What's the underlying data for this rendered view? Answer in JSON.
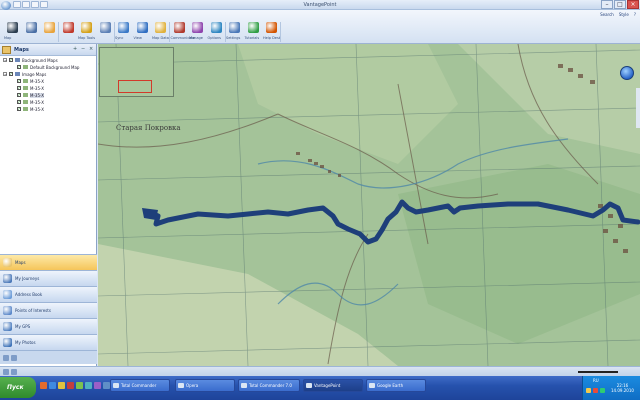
{
  "window": {
    "title": "VantagePoint"
  },
  "ribbon": {
    "search_label": "Search",
    "style_label": "Style",
    "groups": [
      {
        "label": "Map",
        "icon": "map-connect-icon",
        "color": "#2c3e50"
      },
      {
        "label": "",
        "icon": "zoom-icon",
        "color": "#4a6fa5"
      },
      {
        "label": "",
        "icon": "pointer-icon",
        "color": "#e8a33b"
      },
      {
        "label": "",
        "icon": "pin-icon",
        "color": "#c0392b"
      },
      {
        "label": "Map Tools",
        "icon": "tools-icon",
        "color": "#d4a017"
      },
      {
        "label": "",
        "icon": "magnify-icon",
        "color": "#5b7fb5"
      },
      {
        "label": "Sync",
        "icon": "sync-icon",
        "color": "#3a79c7"
      },
      {
        "label": "View",
        "icon": "view-icon",
        "color": "#2f6ec2"
      },
      {
        "label": "Map Data",
        "icon": "data-icon",
        "color": "#e0b13c"
      },
      {
        "label": "Communicate",
        "icon": "communicate-icon",
        "color": "#b03a2e"
      },
      {
        "label": "Manage",
        "icon": "manage-icon",
        "color": "#8e44ad"
      },
      {
        "label": "Options",
        "icon": "options-icon",
        "color": "#2e86c1"
      },
      {
        "label": "Settings",
        "icon": "settings-icon",
        "color": "#4a78b8"
      },
      {
        "label": "Tutorials",
        "icon": "tutorials-icon",
        "color": "#2f9e44"
      },
      {
        "label": "Help Desk",
        "icon": "helpdesk-icon",
        "color": "#d35400"
      }
    ]
  },
  "left_panel": {
    "title": "Maps",
    "tree": [
      {
        "label": "Background Maps",
        "level": 0,
        "checked": true,
        "expanded": true,
        "selected": false
      },
      {
        "label": "Default Background Map",
        "level": 1,
        "checked": true,
        "expanded": false,
        "selected": false
      },
      {
        "label": "Image Maps",
        "level": 0,
        "checked": true,
        "expanded": true,
        "selected": false
      },
      {
        "label": "M-35-X",
        "level": 1,
        "checked": true,
        "expanded": false,
        "selected": false
      },
      {
        "label": "M-35-X",
        "level": 1,
        "checked": true,
        "expanded": false,
        "selected": false
      },
      {
        "label": "M-35-X",
        "level": 1,
        "checked": true,
        "expanded": false,
        "selected": true
      },
      {
        "label": "M-35-X",
        "level": 1,
        "checked": true,
        "expanded": false,
        "selected": false
      },
      {
        "label": "M-35-X",
        "level": 1,
        "checked": true,
        "expanded": false,
        "selected": false
      }
    ],
    "nav": [
      {
        "label": "Maps",
        "icon": "maps-icon",
        "color": "#e9c46a",
        "active": true
      },
      {
        "label": "My Journeys",
        "icon": "journeys-icon",
        "color": "#4a78b8",
        "active": false
      },
      {
        "label": "Address Book",
        "icon": "address-book-icon",
        "color": "#6a9bd8",
        "active": false
      },
      {
        "label": "Points of Interests",
        "icon": "poi-icon",
        "color": "#5b88c9",
        "active": false
      },
      {
        "label": "My GPS",
        "icon": "gps-icon",
        "color": "#4f7fc0",
        "active": false
      },
      {
        "label": "My Photos",
        "icon": "photos-icon",
        "color": "#3f73b8",
        "active": false
      }
    ]
  },
  "map": {
    "labels": [
      {
        "text": "Старая Покровка",
        "id": "label-staraya-pokrovka"
      }
    ],
    "track_color": "#1e3f7a",
    "overview_box_color": "#d23a2a"
  },
  "taskbar": {
    "start_label": "Пуск",
    "tasks": [
      {
        "label": "Total Commander",
        "active": false
      },
      {
        "label": "Opera",
        "active": false
      },
      {
        "label": "Total Commander 7.0",
        "active": false
      },
      {
        "label": "VantagePoint",
        "active": true
      },
      {
        "label": "Google Earth",
        "active": false
      }
    ],
    "tray_lang": "RU",
    "clock_time": "22:16",
    "clock_date": "14.09.2010"
  }
}
